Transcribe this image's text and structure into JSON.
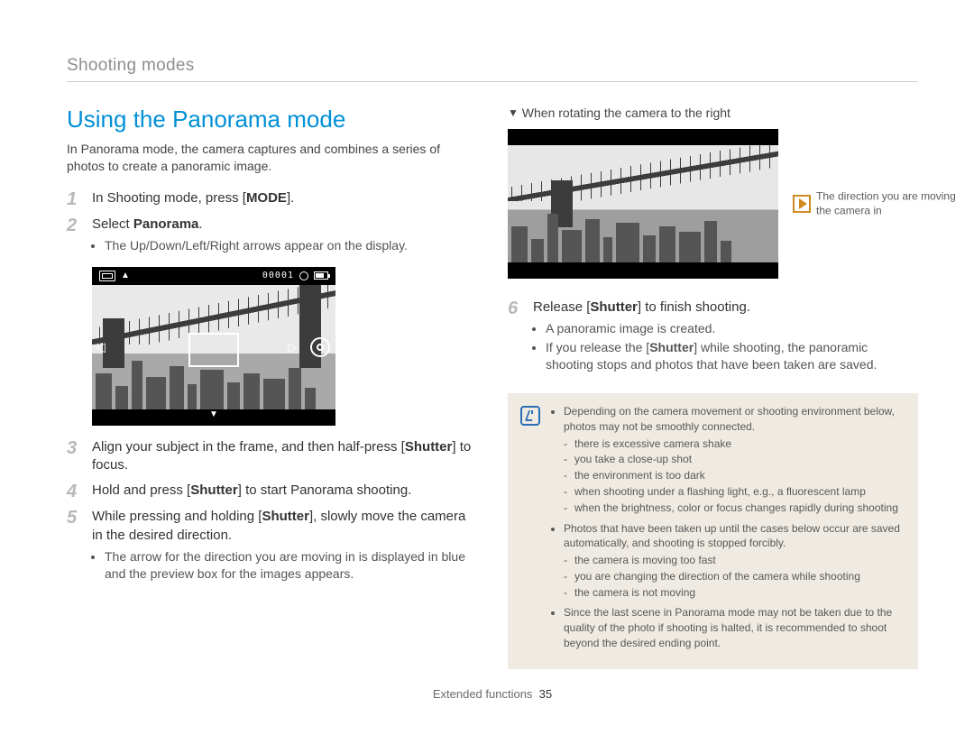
{
  "chapter": "Shooting modes",
  "section_title": "Using the Panorama mode",
  "intro": "In Panorama mode, the camera captures and combines a series of photos to create a panoramic image.",
  "left": {
    "step1": {
      "num": "1",
      "text_a": "In Shooting mode, press [",
      "key": "MODE",
      "text_b": "]."
    },
    "step2": {
      "num": "2",
      "text_a": "Select ",
      "bold": "Panorama",
      "text_b": ".",
      "sub1": "The Up/Down/Left/Right arrows appear on the display."
    },
    "display": {
      "counter": "00001"
    },
    "step3": {
      "num": "3",
      "text_a": "Align your subject in the frame, and then half-press [",
      "bold": "Shutter",
      "text_b": "] to focus."
    },
    "step4": {
      "num": "4",
      "text_a": "Hold and press [",
      "bold": "Shutter",
      "text_b": "] to start Panorama shooting."
    },
    "step5": {
      "num": "5",
      "text_a": "While pressing and holding [",
      "bold": "Shutter",
      "text_b": "], slowly move the camera in the desired direction.",
      "sub1": "The arrow for the direction you are moving in is displayed in blue and the preview box for the images appears."
    }
  },
  "right": {
    "caption": "When rotating the camera to the right",
    "callout": "The direction you are moving the camera in",
    "step6": {
      "num": "6",
      "text_a": "Release [",
      "bold": "Shutter",
      "text_b": "] to finish shooting.",
      "sub1": "A panoramic image is created.",
      "sub2_a": "If you release the [",
      "sub2_bold": "Shutter",
      "sub2_b": "] while shooting, the panoramic shooting stops and photos that have been taken are saved."
    }
  },
  "note": {
    "n1": "Depending on the camera movement or shooting environment below, photos may not be smoothly connected.",
    "n1a": "there is excessive camera shake",
    "n1b": "you take a close-up shot",
    "n1c": "the environment is too dark",
    "n1d": "when shooting under a flashing light, e.g., a fluorescent lamp",
    "n1e": "when the brightness, color or focus changes rapidly during shooting",
    "n2": "Photos that have been taken up until the cases below occur are saved automatically, and shooting is stopped forcibly.",
    "n2a": "the camera is moving too fast",
    "n2b": "you are changing the direction of the camera while shooting",
    "n2c": "the camera is not moving",
    "n3": "Since the last scene in Panorama mode may not be taken due to the quality of the photo if shooting is halted, it is recommended to shoot beyond the desired ending point."
  },
  "footer": {
    "label": "Extended functions",
    "page": "35"
  }
}
